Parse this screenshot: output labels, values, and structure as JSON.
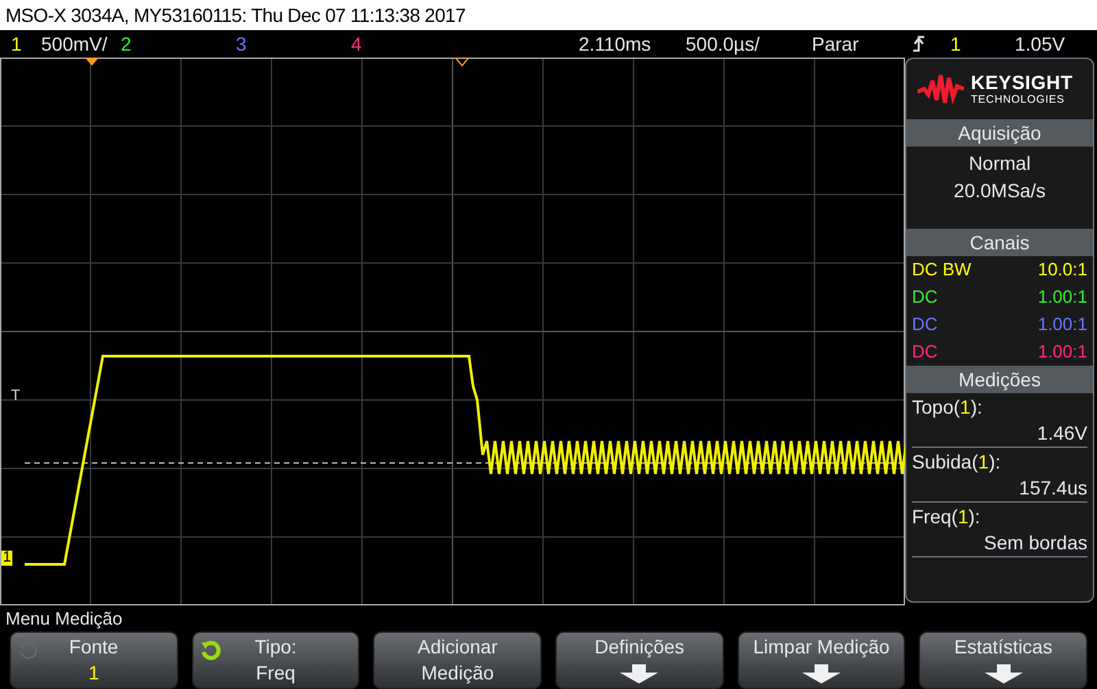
{
  "window": {
    "title": "MSO-X 3034A, MY53160115: Thu Dec 07 11:13:38 2017"
  },
  "status_bar": {
    "channels": [
      {
        "label": "1",
        "scale": "500mV/",
        "color": "#ffff00"
      },
      {
        "label": "2",
        "color": "#33ee33"
      },
      {
        "label": "3",
        "color": "#6677ff"
      },
      {
        "label": "4",
        "color": "#ff2a80"
      }
    ],
    "delay": "2.110ms",
    "timebase": "500.0µs/",
    "run_state": "Parar",
    "trigger": {
      "source": "1",
      "level": "1.05V",
      "color": "#ffff00"
    }
  },
  "screen": {
    "trigger_marker": "T",
    "ground_marker": "1"
  },
  "side_panel": {
    "logo": {
      "brand": "KEYSIGHT",
      "subtitle": "TECHNOLOGIES"
    },
    "acquisition": {
      "heading": "Aquisição",
      "mode": "Normal",
      "rate": "20.0MSa/s"
    },
    "channels": {
      "heading": "Canais",
      "rows": [
        {
          "coupling": "DC BW",
          "probe": "10.0:1",
          "color": "#ffff00"
        },
        {
          "coupling": "DC",
          "probe": "1.00:1",
          "color": "#33ee33"
        },
        {
          "coupling": "DC",
          "probe": "1.00:1",
          "color": "#6677ff"
        },
        {
          "coupling": "DC",
          "probe": "1.00:1",
          "color": "#ff2a80"
        }
      ]
    },
    "measurements": {
      "heading": "Medições",
      "items": [
        {
          "label_parts": [
            "Topo(",
            "1",
            "):"
          ],
          "value": "1.46V"
        },
        {
          "label_parts": [
            "Subida(",
            "1",
            "):"
          ],
          "value": "157.4us"
        },
        {
          "label_parts": [
            "Freq(",
            "1",
            "):"
          ],
          "value": "Sem bordas"
        }
      ]
    }
  },
  "menu": {
    "title": "Menu Medição",
    "softkeys": [
      {
        "kind": "rotary",
        "active": false,
        "label": "Fonte",
        "value": "1"
      },
      {
        "kind": "rotary",
        "active": true,
        "label": "Tipo:",
        "value": "Freq"
      },
      {
        "kind": "text",
        "label": "Adicionar",
        "value": "Medição"
      },
      {
        "kind": "arrow",
        "label": "Definições"
      },
      {
        "kind": "arrow",
        "label": "Limpar Medição"
      },
      {
        "kind": "arrow",
        "label": "Estatísticas"
      }
    ]
  }
}
